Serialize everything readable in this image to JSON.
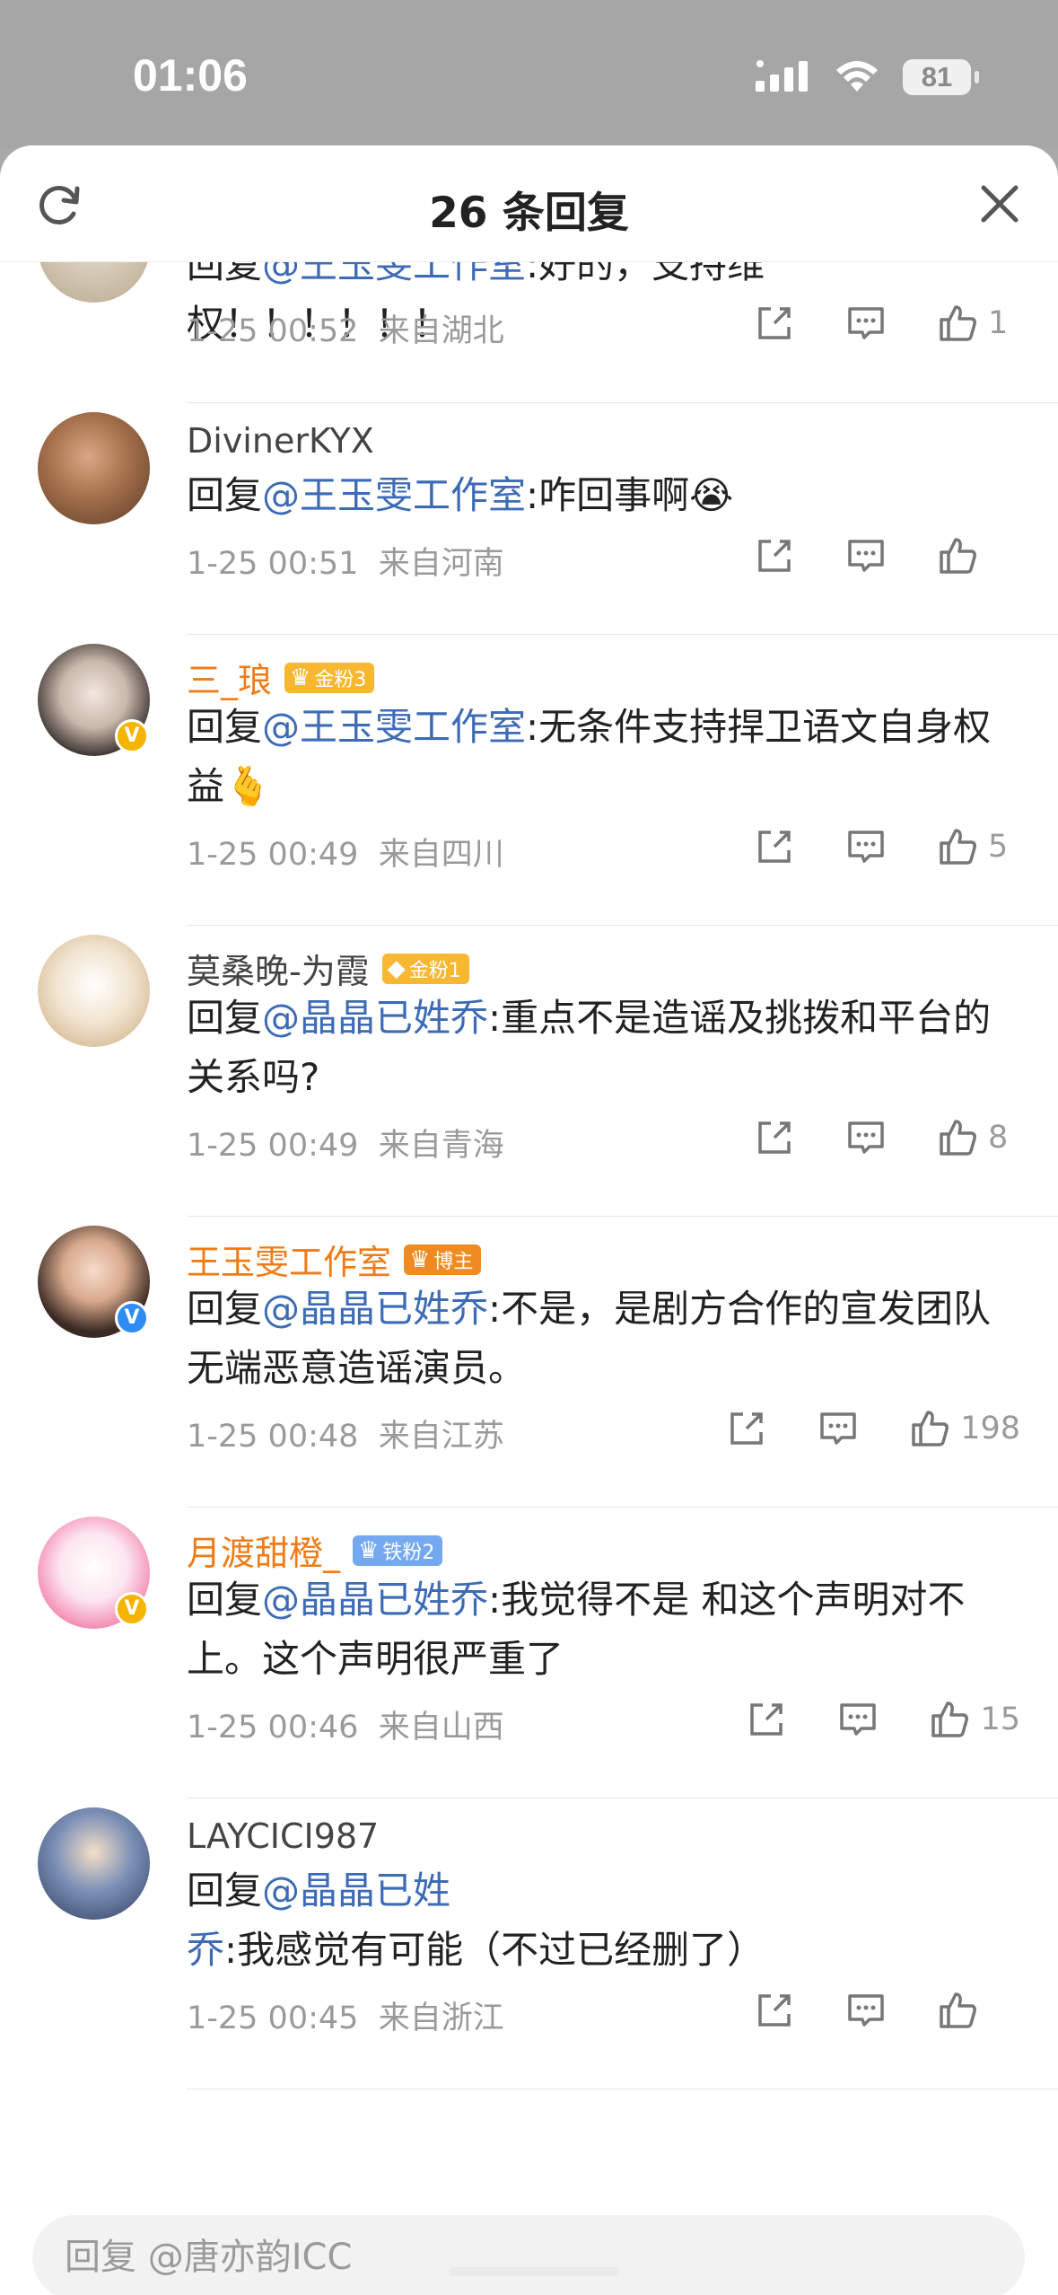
{
  "status": {
    "time": "01:06",
    "battery": "81"
  },
  "header": {
    "title": "26 条回复"
  },
  "comments": [
    {
      "name": "",
      "reply_prefix": "回复",
      "mention": "@王玉雯工作室",
      "text": ":好的，支持维权！！！！！！",
      "date": "1-25 00:52",
      "location": "来自湖北",
      "likes": "1"
    },
    {
      "name": "DivinerKYX",
      "reply_prefix": "回复",
      "mention": "@王玉雯工作室",
      "text": ":咋回事啊😭",
      "date": "1-25 00:51",
      "location": "来自河南",
      "likes": ""
    },
    {
      "name": "三_琅",
      "badge": "金粉3",
      "reply_prefix": "回复",
      "mention": "@王玉雯工作室",
      "text": ":无条件支持捍卫语文自身权益🫰",
      "date": "1-25 00:49",
      "location": "来自四川",
      "likes": "5"
    },
    {
      "name": "莫桑晚-为霞",
      "badge": "金粉1",
      "reply_prefix": "回复",
      "mention": "@晶晶已姓乔",
      "text": ":重点不是造谣及挑拨和平台的关系吗?",
      "date": "1-25 00:49",
      "location": "来自青海",
      "likes": "8"
    },
    {
      "name": "王玉雯工作室",
      "badge": "博主",
      "reply_prefix": "回复",
      "mention": "@晶晶已姓乔",
      "text": ":不是，是剧方合作的宣发团队无端恶意造谣演员。",
      "date": "1-25 00:48",
      "location": "来自江苏",
      "likes": "198"
    },
    {
      "name": "月渡甜橙_",
      "badge": "铁粉2",
      "reply_prefix": "回复",
      "mention": "@晶晶已姓乔",
      "text": ":我觉得不是 和这个声明对不上。这个声明很严重了",
      "date": "1-25 00:46",
      "location": "来自山西",
      "likes": "15"
    },
    {
      "name": "LAYCICI987",
      "reply_prefix": "回复",
      "mention": "@晶晶已姓乔",
      "text": ":我感觉有可能（不过已经删了）",
      "date": "1-25 00:45",
      "location": "来自浙江",
      "likes": ""
    }
  ],
  "reply_bar": {
    "placeholder": "回复 @唐亦韵ICC"
  },
  "colors": {
    "accent_orange": "#f07b16",
    "mention_blue": "#3d6bb5",
    "gold_badge": "#f7b731"
  }
}
